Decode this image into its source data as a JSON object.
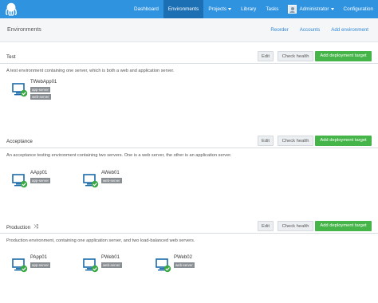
{
  "nav": {
    "items": [
      {
        "label": "Dashboard"
      },
      {
        "label": "Environments"
      },
      {
        "label": "Projects"
      },
      {
        "label": "Library"
      },
      {
        "label": "Tasks"
      },
      {
        "label": "Administrator"
      },
      {
        "label": "Configuration"
      }
    ],
    "active": "Environments",
    "bar_color": "#2f93e0"
  },
  "page": {
    "title": "Environments",
    "links": [
      "Reorder",
      "Accounts",
      "Add environment"
    ]
  },
  "buttons": {
    "edit": "Edit",
    "check_health": "Check health",
    "add_target": "Add deployment target"
  },
  "colors": {
    "accent": "#45b549",
    "link": "#2f86d6",
    "healthy": "#3aa845"
  },
  "environments": [
    {
      "name": "Test",
      "description": "A test environment containing one server, which is both a web and application server.",
      "machines": [
        {
          "name": "TWebApp01",
          "roles": [
            "app-server",
            "web-server"
          ],
          "status": "healthy"
        }
      ]
    },
    {
      "name": "Acceptance",
      "description": "An acceptance testing environment containing two servers. One is a web server, the other is an application server.",
      "machines": [
        {
          "name": "AApp01",
          "roles": [
            "app-server"
          ],
          "status": "healthy"
        },
        {
          "name": "AWeb01",
          "roles": [
            "web-server"
          ],
          "status": "healthy"
        }
      ]
    },
    {
      "name": "Production",
      "icon": "shuffle-icon",
      "description": "Production environment, containing one application server, and two load-balanced web servers.",
      "machines": [
        {
          "name": "PApp01",
          "roles": [
            "app-server"
          ],
          "status": "healthy"
        },
        {
          "name": "PWeb01",
          "roles": [
            "web-server"
          ],
          "status": "healthy"
        },
        {
          "name": "PWeb02",
          "roles": [
            "web-server"
          ],
          "status": "healthy"
        }
      ]
    }
  ]
}
